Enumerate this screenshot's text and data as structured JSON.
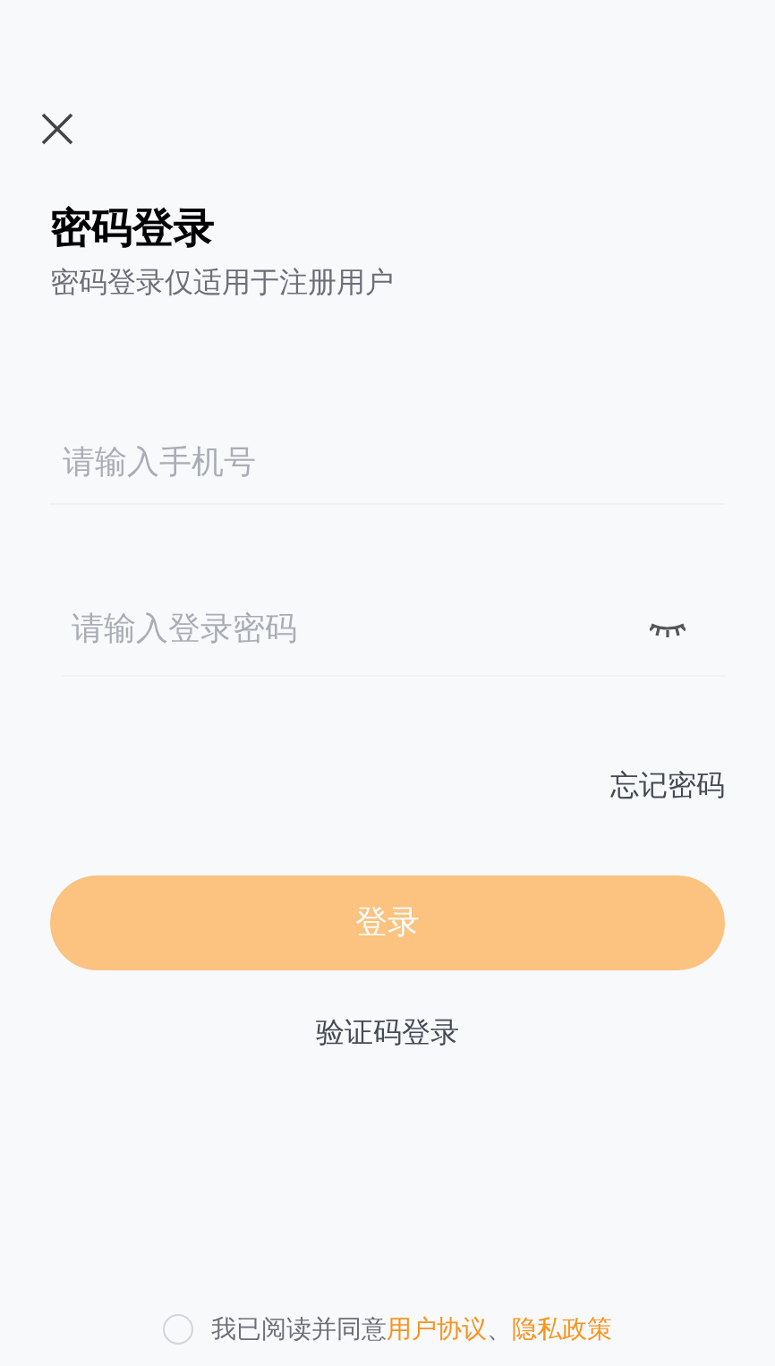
{
  "title": "密码登录",
  "subtitle": "密码登录仅适用于注册用户",
  "phone_field": {
    "placeholder": "请输入手机号"
  },
  "password_field": {
    "placeholder": "请输入登录密码",
    "password_visible": false
  },
  "forgot_password": "忘记密码",
  "login_button": {
    "label": "登录",
    "disabled": true
  },
  "code_login": "验证码登录",
  "agreement": {
    "checked": false,
    "prefix": "我已阅读并同意",
    "links": [
      "用户协议",
      "隐私政策"
    ],
    "separator": "、"
  }
}
